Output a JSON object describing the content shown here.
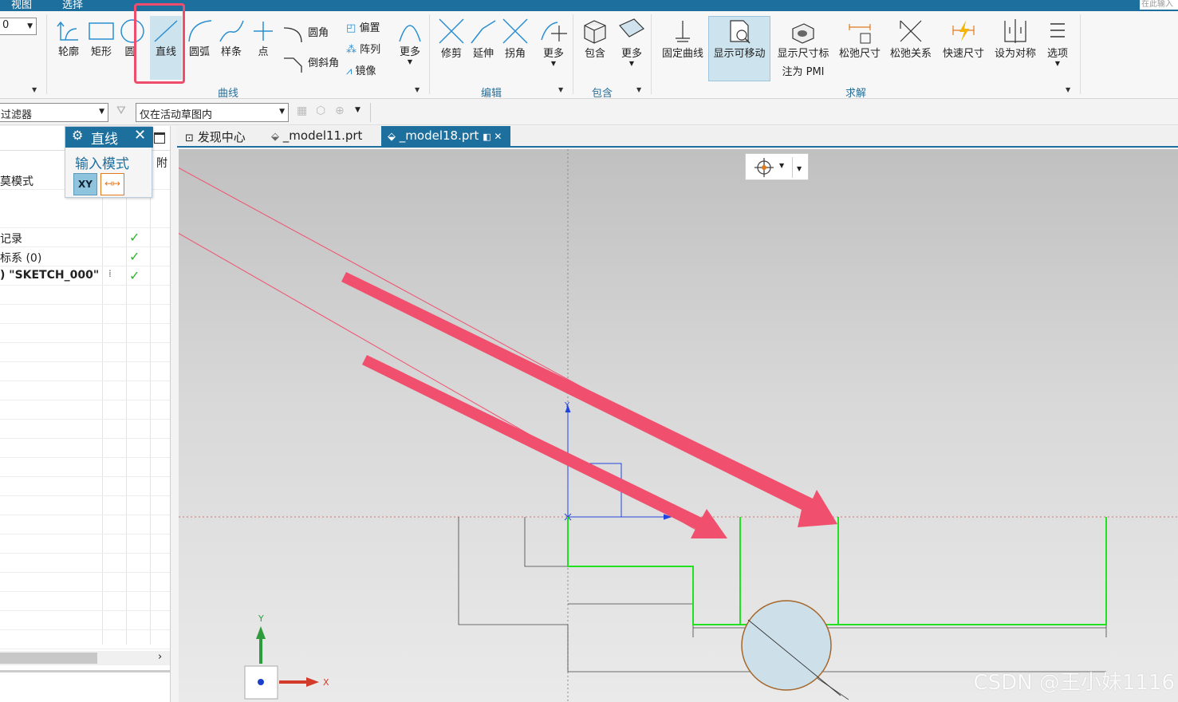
{
  "menubar": {
    "items": [
      "视图",
      "选择"
    ],
    "search_placeholder": "在此输入"
  },
  "ribbon": {
    "left_combo": "0",
    "curve_group": {
      "label": "曲线",
      "buttons": [
        "轮廓",
        "矩形",
        "圆",
        "直线",
        "圆弧",
        "样条",
        "点"
      ],
      "small": [
        "圆角",
        "倒斜角",
        "偏置",
        "阵列",
        "镜像"
      ],
      "more": "更多"
    },
    "edit_group": {
      "label": "编辑",
      "buttons": [
        "修剪",
        "延伸",
        "拐角",
        "更多"
      ]
    },
    "include_group": {
      "label": "包含",
      "buttons": [
        "包含",
        "更多"
      ]
    },
    "solve_group": {
      "label": "求解",
      "buttons": [
        "固定曲线",
        "显示可移动",
        "显示尺寸标注为 PMI",
        "松弛尺寸",
        "松弛关系",
        "快速尺寸",
        "设为对称",
        "选项"
      ],
      "pmi_line1": "显示尺寸标",
      "pmi_line2": "注为 PMI"
    }
  },
  "filterbar": {
    "filter": "过滤器",
    "scope": "仅在活动草图内"
  },
  "navigator": {
    "header_right": "附",
    "rows": [
      "莫模式",
      "",
      "记录",
      "标系 (0)",
      ") \"SKETCH_000\""
    ]
  },
  "line_dialog": {
    "title": "直线",
    "input_mode": "输入模式",
    "xy_label": "XY"
  },
  "tabs": [
    "发现中心",
    "_model11.prt",
    "_model18.prt"
  ],
  "axes": {
    "y": "Y",
    "x": "X"
  },
  "watermark": "CSDN @王小妹1116",
  "colors": {
    "accent": "#1d6f9e",
    "sketch_green": "#22e022",
    "arrow": "#f0506e",
    "highlight_box": "#ee4d6b"
  }
}
